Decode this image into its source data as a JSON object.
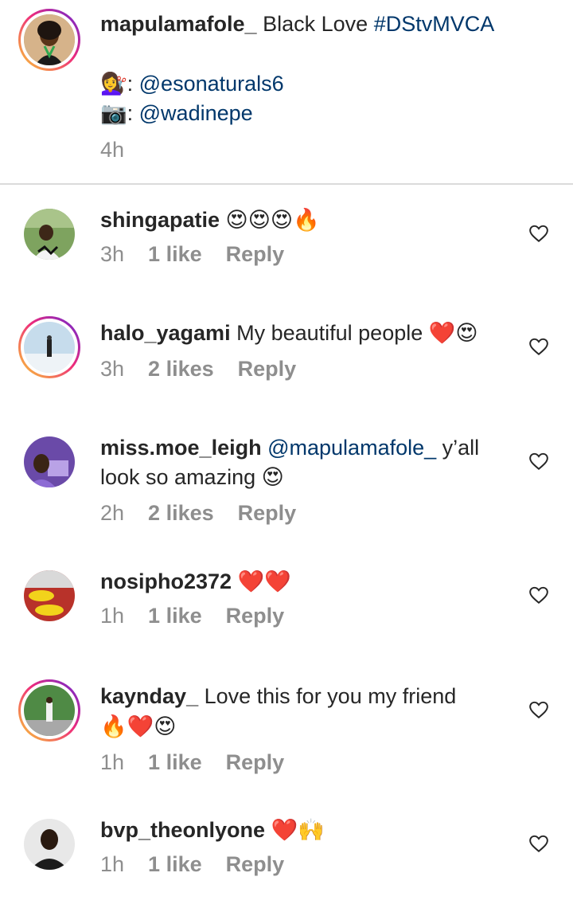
{
  "post": {
    "username": "mapulamafole_",
    "caption_text": "Black Love",
    "hashtag": "#DStvMVCA",
    "credit_1_icon": "hairdresser-emoji",
    "credit_1_handle": "@esonaturals6",
    "credit_2_icon": "camera-emoji",
    "credit_2_handle": "@wadinepe",
    "time": "4h"
  },
  "comments": [
    {
      "username": "shingapatie",
      "text": "",
      "emojis": "😍😍😍🔥",
      "time": "3h",
      "likes": "1 like",
      "reply": "Reply"
    },
    {
      "username": "halo_yagami",
      "text": "My beautiful people",
      "emojis": "❤️😍",
      "time": "3h",
      "likes": "2 likes",
      "reply": "Reply"
    },
    {
      "username": "miss.moe_leigh",
      "mention": "@mapulamafole_",
      "text_1": "y’all",
      "text_2": "look so amazing",
      "emojis": "😍",
      "time": "2h",
      "likes": "2 likes",
      "reply": "Reply"
    },
    {
      "username": "nosipho2372",
      "text": "",
      "emojis": "❤️❤️",
      "time": "1h",
      "likes": "1 like",
      "reply": "Reply"
    },
    {
      "username": "kaynday_",
      "text": "Love this for you my friend",
      "emojis": "🔥❤️😍",
      "time": "1h",
      "likes": "1 like",
      "reply": "Reply"
    },
    {
      "username": "bvp_theonlyone",
      "text": "",
      "emojis": "❤️🙌",
      "time": "1h",
      "likes": "1 like",
      "reply": "Reply"
    }
  ],
  "colors": {
    "link": "#00376b",
    "heart": "#e0182b",
    "meta": "#8e8e8e"
  }
}
